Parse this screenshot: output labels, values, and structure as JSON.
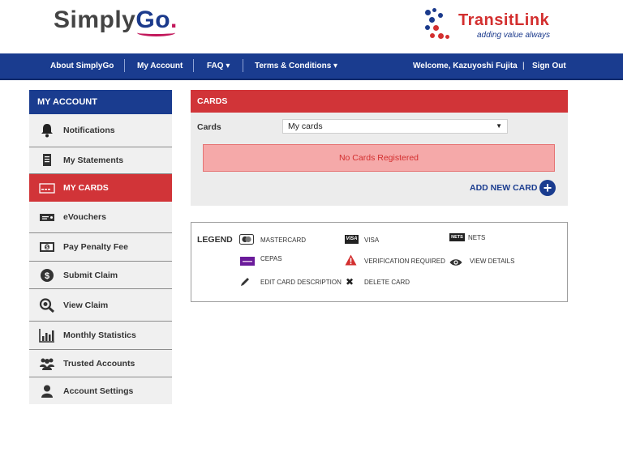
{
  "header": {
    "brand_simply": "Simply",
    "brand_go": "Go",
    "brand_dot": ".",
    "transitlink_name": "TransitLink",
    "transitlink_tagline": "adding value always"
  },
  "nav": {
    "about": "About SimplyGo",
    "my_account": "My Account",
    "faq": "FAQ",
    "terms": "Terms & Conditions",
    "caret": "▾",
    "welcome": "Welcome, Kazuyoshi Fujita",
    "sep": "|",
    "sign_out": "Sign Out"
  },
  "sidebar": {
    "heading": "MY ACCOUNT",
    "items": [
      {
        "label": "Notifications",
        "icon": "bell-icon"
      },
      {
        "label": "My Statements",
        "icon": "statement-icon"
      },
      {
        "label": "MY CARDS",
        "icon": "card-icon",
        "active": true
      },
      {
        "label": "eVouchers",
        "icon": "voucher-icon"
      },
      {
        "label": "Pay Penalty Fee",
        "icon": "money-icon"
      },
      {
        "label": "Submit Claim",
        "icon": "dollar-coin-icon"
      },
      {
        "label": "View Claim",
        "icon": "magnifier-icon"
      },
      {
        "label": "Monthly Statistics",
        "icon": "bar-chart-icon"
      },
      {
        "label": "Trusted Accounts",
        "icon": "group-icon"
      },
      {
        "label": "Account Settings",
        "icon": "user-icon"
      }
    ]
  },
  "cards": {
    "heading": "CARDS",
    "field_label": "Cards",
    "select_value": "My cards",
    "select_caret": "▼",
    "empty_message": "No Cards Registered",
    "add_label": "ADD NEW CARD",
    "add_symbol": "+"
  },
  "legend": {
    "title": "LEGEND",
    "mastercard": "MASTERCARD",
    "visa": "VISA",
    "visa_badge": "VISA",
    "nets": "NETS",
    "nets_badge": "NETS",
    "cepas": "CEPAS",
    "verification": "VERIFICATION REQUIRED",
    "view_details": "VIEW DETAILS",
    "edit": "EDIT CARD DESCRIPTION",
    "delete": "DELETE CARD",
    "delete_symbol": "✖"
  },
  "colors": {
    "nav_blue": "#1a3c8f",
    "active_red": "#d13438",
    "alert_pink": "#f5a9a9"
  }
}
